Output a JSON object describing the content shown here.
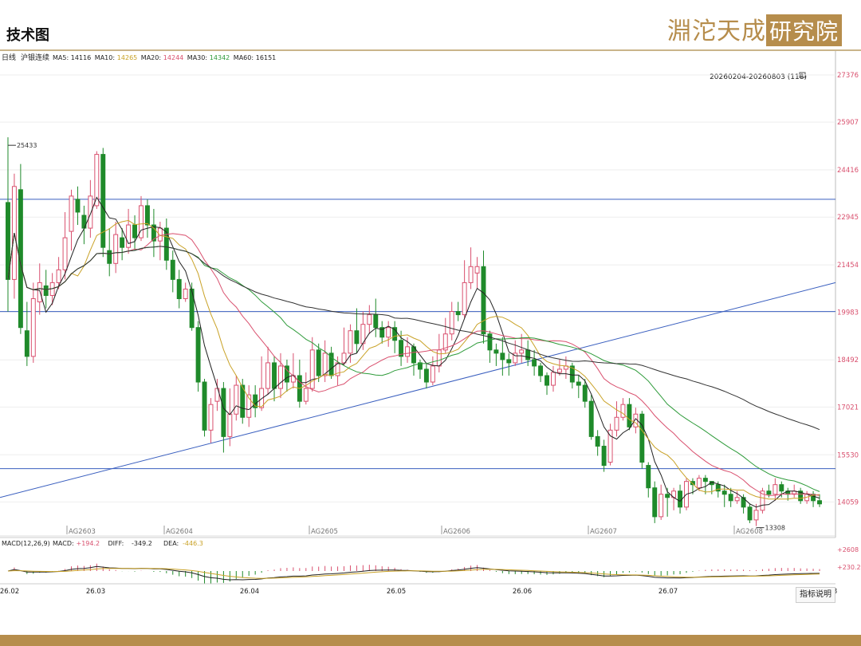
{
  "header": {
    "title": "技术图"
  },
  "brand": {
    "name": "淵沱天成",
    "name_boxed": "研究院"
  },
  "chart_data": {
    "type": "candlestick",
    "legend_line": {
      "period": "日线",
      "symbol": "沪银连续",
      "ma": [
        {
          "label": "MA5:",
          "value": "14116",
          "color": "#222222"
        },
        {
          "label": "MA10:",
          "value": "14265",
          "color": "#c9a227"
        },
        {
          "label": "MA20:",
          "value": "14244",
          "color": "#d9506e"
        },
        {
          "label": "MA30:",
          "value": "14342",
          "color": "#2e9b3a"
        },
        {
          "label": "MA60:",
          "value": "16151",
          "color": "#222222"
        }
      ]
    },
    "range_label": "20260204-20260803 (118)",
    "y_ticks": [
      "27376",
      "25907",
      "24416",
      "22945",
      "21454",
      "19983",
      "18492",
      "17021",
      "15530",
      "14059"
    ],
    "high_marker": "25433",
    "low_marker": "13308",
    "contracts": [
      "AG2603",
      "AG2604",
      "AG2605",
      "AG2606",
      "AG2607",
      "AG2608"
    ],
    "x_ticks": [
      "26.02",
      "26.03",
      "26.04",
      "26.05",
      "26.06",
      "26.07",
      "26.08"
    ],
    "candles": [
      [
        23400,
        21000,
        25433,
        20000
      ],
      [
        21000,
        23900,
        24300,
        20400
      ],
      [
        23800,
        19500,
        24600,
        19300
      ],
      [
        19400,
        18600,
        20300,
        18300
      ],
      [
        18600,
        20400,
        20900,
        18400
      ],
      [
        20300,
        20900,
        21500,
        19900
      ],
      [
        20800,
        20500,
        21300,
        20100
      ],
      [
        20500,
        20900,
        21200,
        20200
      ],
      [
        20900,
        21300,
        21700,
        20700
      ],
      [
        21300,
        22300,
        23100,
        21000
      ],
      [
        22500,
        23600,
        23800,
        21900
      ],
      [
        23500,
        23100,
        23900,
        22700
      ],
      [
        23000,
        22600,
        23300,
        22100
      ],
      [
        22600,
        23600,
        24100,
        22300
      ],
      [
        23300,
        24900,
        25000,
        23200
      ],
      [
        24900,
        22000,
        25100,
        21700
      ],
      [
        21900,
        21500,
        22600,
        21100
      ],
      [
        21500,
        22400,
        22800,
        21200
      ],
      [
        22300,
        22000,
        22600,
        21600
      ],
      [
        22000,
        22700,
        23200,
        21800
      ],
      [
        22700,
        22300,
        23000,
        21900
      ],
      [
        22300,
        23300,
        23600,
        22200
      ],
      [
        23300,
        22700,
        23500,
        22300
      ],
      [
        22700,
        22200,
        23200,
        21700
      ],
      [
        22200,
        22600,
        22800,
        21600
      ],
      [
        22600,
        21600,
        22900,
        21300
      ],
      [
        21600,
        21000,
        21900,
        20600
      ],
      [
        21000,
        20400,
        21300,
        20100
      ],
      [
        20400,
        20700,
        20900,
        20300
      ],
      [
        20700,
        19500,
        20900,
        19400
      ],
      [
        19500,
        17800,
        19700,
        17500
      ],
      [
        17800,
        16300,
        17900,
        16100
      ],
      [
        16300,
        17100,
        17300,
        15900
      ],
      [
        17200,
        17600,
        17900,
        16900
      ],
      [
        17600,
        16100,
        17800,
        15600
      ],
      [
        16100,
        16800,
        17600,
        15800
      ],
      [
        16800,
        17700,
        18000,
        16600
      ],
      [
        17700,
        16700,
        17900,
        16500
      ],
      [
        16700,
        17400,
        17700,
        16400
      ],
      [
        17400,
        17000,
        17700,
        16700
      ],
      [
        17000,
        17600,
        18600,
        16900
      ],
      [
        17600,
        18400,
        18900,
        17400
      ],
      [
        18400,
        17600,
        18600,
        17200
      ],
      [
        17600,
        18300,
        18700,
        17300
      ],
      [
        18300,
        17800,
        18500,
        17500
      ],
      [
        17800,
        18000,
        18700,
        17600
      ],
      [
        18000,
        17200,
        18500,
        17000
      ],
      [
        17200,
        17600,
        18100,
        17100
      ],
      [
        17600,
        18800,
        19200,
        17500
      ],
      [
        18800,
        18000,
        19000,
        17800
      ],
      [
        18000,
        18700,
        19100,
        17800
      ],
      [
        18700,
        18000,
        18900,
        17900
      ],
      [
        18000,
        18400,
        18600,
        17700
      ],
      [
        18400,
        18700,
        19500,
        18300
      ],
      [
        18700,
        19400,
        19600,
        18400
      ],
      [
        19400,
        19000,
        20100,
        18700
      ],
      [
        19000,
        19600,
        20000,
        18800
      ],
      [
        19600,
        19900,
        20200,
        19300
      ],
      [
        19900,
        19500,
        20400,
        19200
      ],
      [
        19500,
        19200,
        19700,
        19000
      ],
      [
        19200,
        19500,
        19700,
        18900
      ],
      [
        19500,
        19100,
        19700,
        18700
      ],
      [
        19100,
        18600,
        19400,
        18300
      ],
      [
        18600,
        18900,
        19200,
        18400
      ],
      [
        18900,
        18400,
        19000,
        18000
      ],
      [
        18400,
        18200,
        18500,
        17900
      ],
      [
        18200,
        17800,
        18400,
        17600
      ],
      [
        17800,
        18300,
        18600,
        17700
      ],
      [
        18300,
        18800,
        19300,
        18100
      ],
      [
        18800,
        19300,
        19800,
        18700
      ],
      [
        19300,
        20000,
        20300,
        19100
      ],
      [
        20000,
        19900,
        20300,
        19700
      ],
      [
        19900,
        20900,
        21600,
        19800
      ],
      [
        20900,
        21400,
        22000,
        20700
      ],
      [
        21200,
        21400,
        21700,
        20700
      ],
      [
        21400,
        19300,
        21900,
        19000
      ],
      [
        19300,
        18800,
        19400,
        18400
      ],
      [
        18800,
        18700,
        19000,
        18300
      ],
      [
        18700,
        18500,
        19200,
        18000
      ],
      [
        18500,
        18400,
        18700,
        18000
      ],
      [
        18400,
        18700,
        19100,
        18300
      ],
      [
        18700,
        18800,
        19300,
        18400
      ],
      [
        18800,
        18500,
        19100,
        18300
      ],
      [
        18500,
        18300,
        18800,
        18000
      ],
      [
        18300,
        18000,
        18400,
        17800
      ],
      [
        18000,
        17700,
        18100,
        17400
      ],
      [
        17700,
        18100,
        18300,
        17500
      ],
      [
        18100,
        18200,
        18500,
        18000
      ],
      [
        18200,
        18300,
        18600,
        17900
      ],
      [
        18300,
        17800,
        18400,
        17600
      ],
      [
        17800,
        17700,
        18000,
        17300
      ],
      [
        17700,
        17200,
        17900,
        17000
      ],
      [
        17200,
        16100,
        17400,
        16000
      ],
      [
        16100,
        15800,
        16300,
        15500
      ],
      [
        15800,
        15200,
        16000,
        15000
      ],
      [
        15300,
        16300,
        16500,
        15200
      ],
      [
        16300,
        16700,
        17200,
        16100
      ],
      [
        16700,
        17100,
        17300,
        16600
      ],
      [
        17100,
        16400,
        17300,
        16300
      ],
      [
        16400,
        16800,
        17000,
        16200
      ],
      [
        16800,
        15300,
        16900,
        15100
      ],
      [
        15200,
        14500,
        15300,
        14200
      ],
      [
        14500,
        13600,
        14700,
        13400
      ],
      [
        13600,
        14300,
        14600,
        13500
      ],
      [
        14300,
        14200,
        14500,
        13600
      ],
      [
        14200,
        14400,
        14500,
        13800
      ],
      [
        14400,
        13900,
        14600,
        13700
      ],
      [
        13900,
        14700,
        14800,
        13800
      ],
      [
        14700,
        14600,
        14800,
        14300
      ],
      [
        14500,
        14800,
        14900,
        14400
      ],
      [
        14800,
        14700,
        14900,
        14300
      ],
      [
        14700,
        14600,
        14700,
        14300
      ],
      [
        14600,
        14400,
        14700,
        14200
      ],
      [
        14400,
        14300,
        14600,
        13900
      ],
      [
        14300,
        14100,
        14500,
        13900
      ],
      [
        14100,
        14200,
        14400,
        14000
      ],
      [
        14200,
        13900,
        14300,
        13700
      ],
      [
        13900,
        13500,
        14000,
        13400
      ],
      [
        13500,
        13800,
        14000,
        13308
      ],
      [
        13800,
        14400,
        14500,
        13700
      ],
      [
        14400,
        14300,
        14600,
        14200
      ],
      [
        14300,
        14600,
        14800,
        14100
      ],
      [
        14600,
        14400,
        14700,
        14200
      ],
      [
        14400,
        14300,
        14500,
        14100
      ],
      [
        14300,
        14400,
        14600,
        14200
      ],
      [
        14400,
        14100,
        14500,
        14000
      ],
      [
        14100,
        14300,
        14400,
        14000
      ],
      [
        14300,
        14100,
        14400,
        13900
      ],
      [
        14100,
        14000,
        14300,
        13900
      ]
    ],
    "indicator": {
      "label": "MACD(12,26,9)",
      "items": [
        {
          "label": "MACD:",
          "value": "+194.2",
          "color": "#d9506e"
        },
        {
          "label": "DIFF:",
          "value": "-349.2",
          "color": "#222222"
        },
        {
          "label": "DEA:",
          "value": "-446.3",
          "color": "#c9a227"
        }
      ],
      "y_ticks": [
        "+2608",
        "+230.2"
      ]
    },
    "button_label": "指标说明",
    "colors": {
      "up": "#d9506e",
      "down": "#1f8a2a",
      "ma5": "#222222",
      "ma10": "#c9a227",
      "ma20": "#d9506e",
      "ma30": "#2e9b3a",
      "ma60": "#333333",
      "hline": "#3a5fbf",
      "trend": "#3a5fbf"
    },
    "horizontal_levels": [
      23500,
      20000,
      15100
    ],
    "trendline": {
      "from": {
        "bar": 0,
        "value": 14200
      },
      "to": {
        "bar": 117,
        "value": 20900
      }
    }
  }
}
